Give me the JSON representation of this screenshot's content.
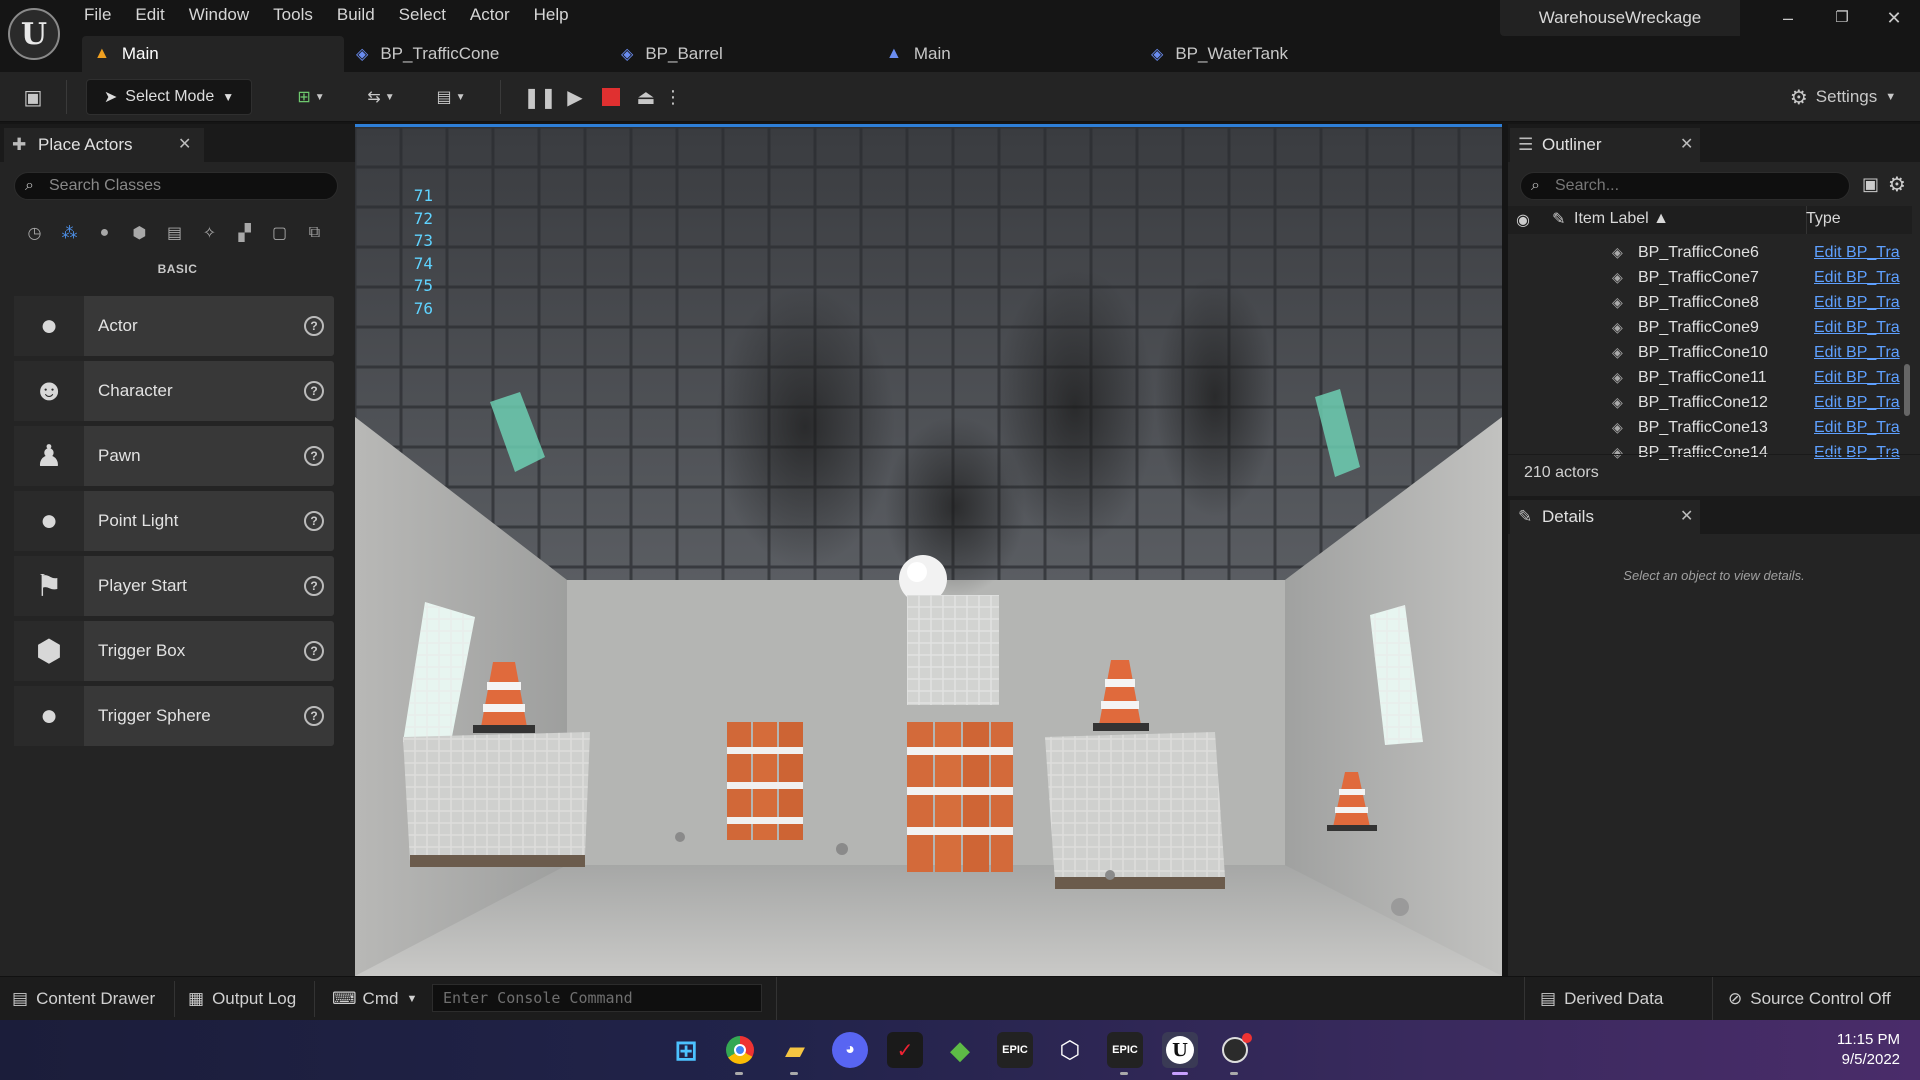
{
  "app": {
    "logo": "U",
    "project_name": "WarehouseWreckage"
  },
  "menu": [
    "File",
    "Edit",
    "Window",
    "Tools",
    "Build",
    "Select",
    "Actor",
    "Help"
  ],
  "window_controls": {
    "minimize": "–",
    "restore": "❐",
    "close": "✕"
  },
  "tabs": [
    {
      "label": "Main",
      "icon": "level-icon"
    },
    {
      "label": "BP_TrafficCone",
      "icon": "blueprint-icon"
    },
    {
      "label": "BP_Barrel",
      "icon": "blueprint-icon"
    },
    {
      "label": "Main",
      "icon": "level-icon"
    },
    {
      "label": "BP_WaterTank",
      "icon": "blueprint-icon"
    }
  ],
  "toolbar": {
    "select_mode": "Select Mode",
    "settings": "Settings"
  },
  "place_actors": {
    "title": "Place Actors",
    "search_placeholder": "Search Classes",
    "section": "BASIC",
    "items": [
      {
        "label": "Actor",
        "icon": "sphere-icon"
      },
      {
        "label": "Character",
        "icon": "character-icon"
      },
      {
        "label": "Pawn",
        "icon": "pawn-icon"
      },
      {
        "label": "Point Light",
        "icon": "lightbulb-icon"
      },
      {
        "label": "Player Start",
        "icon": "flag-icon"
      },
      {
        "label": "Trigger Box",
        "icon": "box-icon"
      },
      {
        "label": "Trigger Sphere",
        "icon": "sphere-icon"
      }
    ]
  },
  "viewport": {
    "stat_lines": [
      "71",
      "72",
      "73",
      "74",
      "75",
      "76"
    ]
  },
  "outliner": {
    "title": "Outliner",
    "search_placeholder": "Search...",
    "col_label": "Item Label ▲",
    "col_type": "Type",
    "rows": [
      {
        "name": "BP_TrafficCone6",
        "type": "Edit BP_Tra"
      },
      {
        "name": "BP_TrafficCone7",
        "type": "Edit BP_Tra"
      },
      {
        "name": "BP_TrafficCone8",
        "type": "Edit BP_Tra"
      },
      {
        "name": "BP_TrafficCone9",
        "type": "Edit BP_Tra"
      },
      {
        "name": "BP_TrafficCone10",
        "type": "Edit BP_Tra"
      },
      {
        "name": "BP_TrafficCone11",
        "type": "Edit BP_Tra"
      },
      {
        "name": "BP_TrafficCone12",
        "type": "Edit BP_Tra"
      },
      {
        "name": "BP_TrafficCone13",
        "type": "Edit BP_Tra"
      },
      {
        "name": "BP_TrafficCone14",
        "type": "Edit BP_Tra"
      }
    ],
    "count": "210 actors"
  },
  "details": {
    "title": "Details",
    "empty_message": "Select an object to view details."
  },
  "bottom": {
    "content_drawer": "Content Drawer",
    "output_log": "Output Log",
    "cmd": "Cmd",
    "console_placeholder": "Enter Console Command",
    "derived_data": "Derived Data",
    "source_control": "Source Control Off"
  },
  "taskbar": {
    "apps": [
      "windows-start-icon",
      "chrome-icon",
      "file-explorer-icon",
      "discord-icon",
      "vivaldi-icon",
      "minecraft-icon",
      "epic-games-icon",
      "unity-icon",
      "epic-games-icon",
      "unreal-engine-icon",
      "obs-icon"
    ],
    "epic_label": "EPIC",
    "time": "11:15 PM",
    "date": "9/5/2022"
  },
  "colors": {
    "accent": "#2e7fd8",
    "link": "#5ea0ff",
    "stat_text": "#5fd3ff",
    "stop": "#e03030"
  }
}
